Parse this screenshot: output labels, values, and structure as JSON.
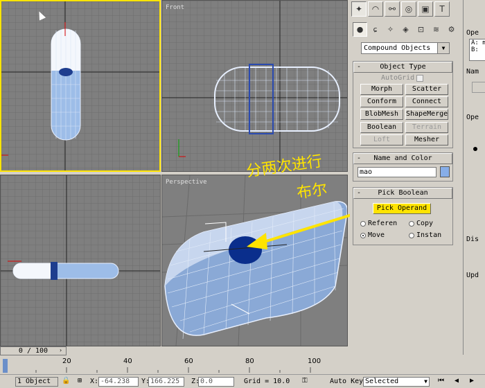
{
  "viewports": {
    "top": {
      "label": ""
    },
    "front": {
      "label": "Front"
    },
    "left": {
      "label": ""
    },
    "perspective": {
      "label": "Perspective"
    }
  },
  "annotation": {
    "line1": "分两次进行",
    "line2": "布尔",
    "color": "#ffe400"
  },
  "command_panel": {
    "tabs": [
      "create-icon",
      "modify-icon",
      "hierarchy-icon",
      "motion-icon",
      "display-icon",
      "utilities-icon"
    ],
    "category_dropdown": "Compound Objects",
    "object_type": {
      "title": "Object Type",
      "autogrid_label": "AutoGrid",
      "buttons": [
        {
          "label": "Morph",
          "enabled": true
        },
        {
          "label": "Scatter",
          "enabled": true
        },
        {
          "label": "Conform",
          "enabled": true
        },
        {
          "label": "Connect",
          "enabled": true
        },
        {
          "label": "BlobMesh",
          "enabled": true
        },
        {
          "label": "ShapeMerge",
          "enabled": true
        },
        {
          "label": "Boolean",
          "enabled": true
        },
        {
          "label": "Terrain",
          "enabled": false
        },
        {
          "label": "Loft",
          "enabled": false
        },
        {
          "label": "Mesher",
          "enabled": true
        }
      ]
    },
    "name_color": {
      "title": "Name and Color",
      "name_value": "mao",
      "swatch_color": "#87aee8"
    },
    "pick_boolean": {
      "title": "Pick Boolean",
      "pick_button": "Pick Operand",
      "options": [
        {
          "label": "Referen",
          "selected": false
        },
        {
          "label": "Copy",
          "selected": false
        },
        {
          "label": "Move",
          "selected": true
        },
        {
          "label": "Instan",
          "selected": false
        }
      ]
    },
    "minus": "-"
  },
  "side_panel": {
    "ope1": "Ope",
    "a": "A: m",
    "b": "B:",
    "nam": "Nam",
    "ope2": "Ope",
    "dis": "Dis",
    "upd": "Upd"
  },
  "timeline": {
    "slider": "0 / 100",
    "ticks": [
      "20",
      "40",
      "60",
      "80",
      "100"
    ]
  },
  "status": {
    "selection": "1 Object",
    "x_label": "X:",
    "x_value": "-64.238",
    "y_label": "Y:",
    "y_value": "166.225",
    "z_label": "Z:",
    "z_value": "0.0",
    "grid": "Grid = 10.0",
    "autokey": "Auto Key",
    "selected": "Selected"
  }
}
